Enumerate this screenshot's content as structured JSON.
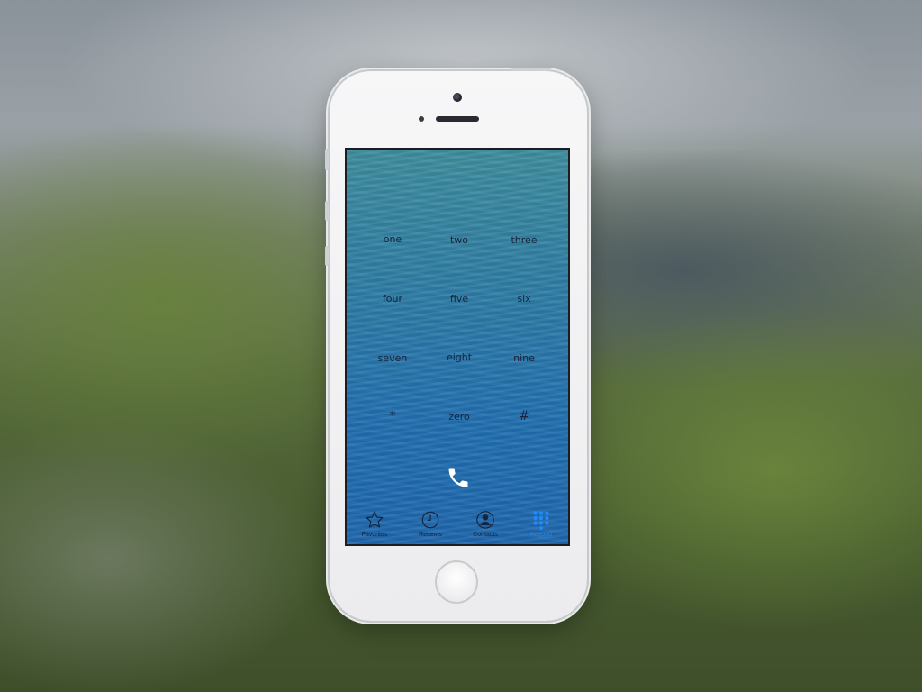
{
  "keypad": {
    "keys": [
      {
        "label": "one"
      },
      {
        "label": "two"
      },
      {
        "label": "three"
      },
      {
        "label": "four"
      },
      {
        "label": "five"
      },
      {
        "label": "six"
      },
      {
        "label": "seven"
      },
      {
        "label": "eight"
      },
      {
        "label": "nine"
      },
      {
        "label": "*"
      },
      {
        "label": "zero"
      },
      {
        "label": "#"
      }
    ],
    "call_icon": "phone-icon"
  },
  "tabbar": {
    "active": "Keypad",
    "tabs": [
      {
        "label": "Favorites",
        "icon": "star-icon"
      },
      {
        "label": "Recents",
        "icon": "clock-icon"
      },
      {
        "label": "Contacts",
        "icon": "person-icon"
      },
      {
        "label": "Keypad",
        "icon": "keypad-grid-icon"
      }
    ]
  },
  "colors": {
    "active_tab": "#1e8bff",
    "label_text": "#18243a",
    "screen_water": "#2170b2"
  }
}
